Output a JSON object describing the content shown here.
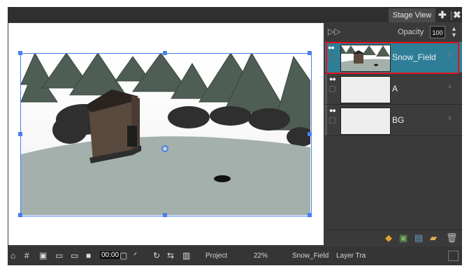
{
  "tab": {
    "title": "Stage View"
  },
  "layer_panel": {
    "opacity_label": "Opacity",
    "opacity_value": "100",
    "layers": [
      {
        "name": "Snow_Field",
        "selected": true
      },
      {
        "name": "A",
        "selected": false
      },
      {
        "name": "BG",
        "selected": false
      }
    ]
  },
  "statusbar": {
    "view_mode": "Project",
    "zoom": "22%",
    "layer": "Snow_Field",
    "transform_label": "Layer Tra",
    "frame_counter": "00:00"
  },
  "colors": {
    "selection": "#2e7e98",
    "highlight_outline": "#e0101a",
    "bounding_box": "#4a7ff0"
  }
}
